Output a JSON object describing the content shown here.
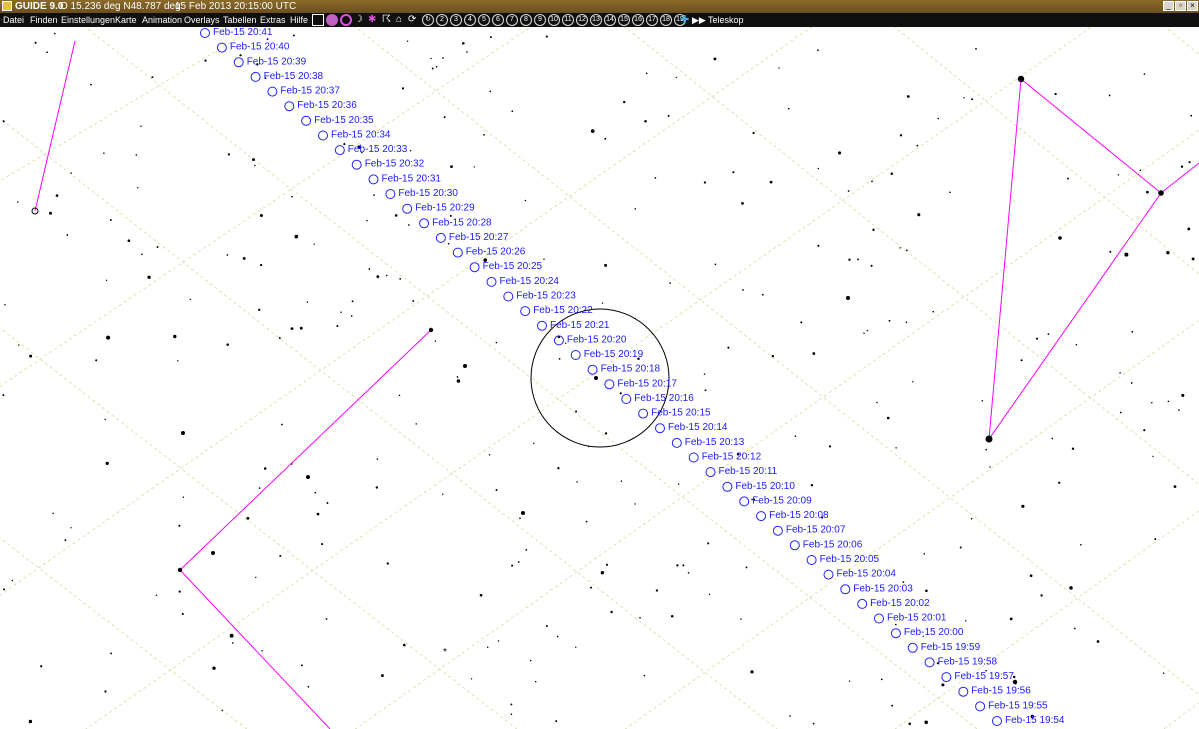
{
  "window": {
    "title": "GUIDE 9.0",
    "coords": "O 15.236 deg N48.787 deg",
    "datetime": "15 Feb 2013 20:15:00 UTC"
  },
  "menu": [
    "Datei",
    "Finden",
    "Einstellungen",
    "Karte",
    "Animation",
    "Overlays",
    "Tabellen",
    "Extras",
    "Hilfe"
  ],
  "toolbar": {
    "numbered_buttons": [
      "2",
      "3",
      "4",
      "5",
      "6",
      "7",
      "8",
      "9",
      "10",
      "11",
      "12",
      "13",
      "14",
      "15",
      "16",
      "17",
      "18",
      "19"
    ],
    "telescope_label": "Teleskop",
    "icons": [
      "globe-icon",
      "planet-icon",
      "moon-icon",
      "star-icon",
      "comet-icon",
      "hand-icon",
      "house-icon",
      "refresh-icon",
      "crosshair-icon",
      "fast-forward-icon"
    ]
  },
  "track": {
    "labels": [
      "Feb-15 20:41",
      "Feb-15 20:40",
      "Feb-15 20:39",
      "Feb-15 20:38",
      "Feb-15 20:37",
      "Feb-15 20:36",
      "Feb-15 20:35",
      "Feb-15 20:34",
      "Feb-15 20:33",
      "Feb-15 20:32",
      "Feb-15 20:31",
      "Feb-15 20:30",
      "Feb-15 20:29",
      "Feb-15 20:28",
      "Feb-15 20:27",
      "Feb-15 20:26",
      "Feb-15 20:25",
      "Feb-15 20:24",
      "Feb-15 20:23",
      "Feb-15 20:22",
      "Feb-15 20:21",
      "Feb-15 20:20",
      "Feb-15 20:19",
      "Feb-15 20:18",
      "Feb-15 20:17",
      "Feb-15 20:16",
      "Feb-15 20:15",
      "Feb-15 20:14",
      "Feb-15 20:13",
      "Feb-15 20:12",
      "Feb-15 20:11",
      "Feb-15 20:10",
      "Feb-15 20:09",
      "Feb-15 20:08",
      "Feb-15 20:07",
      "Feb-15 20:06",
      "Feb-15 20:05",
      "Feb-15 20:04",
      "Feb-15 20:03",
      "Feb-15 20:02",
      "Feb-15 20:01",
      "Feb-15 20:00",
      "Feb-15 19:59",
      "Feb-15 19:58",
      "Feb-15 19:57",
      "Feb-15 19:56",
      "Feb-15 19:55",
      "Feb-15 19:54"
    ]
  },
  "colors": {
    "title_bar": "#7a5c24",
    "menu_bar": "#101010",
    "track_marker": "#2020ff",
    "constellation_line": "#ff00ff",
    "grid": "#d8d8a0"
  }
}
